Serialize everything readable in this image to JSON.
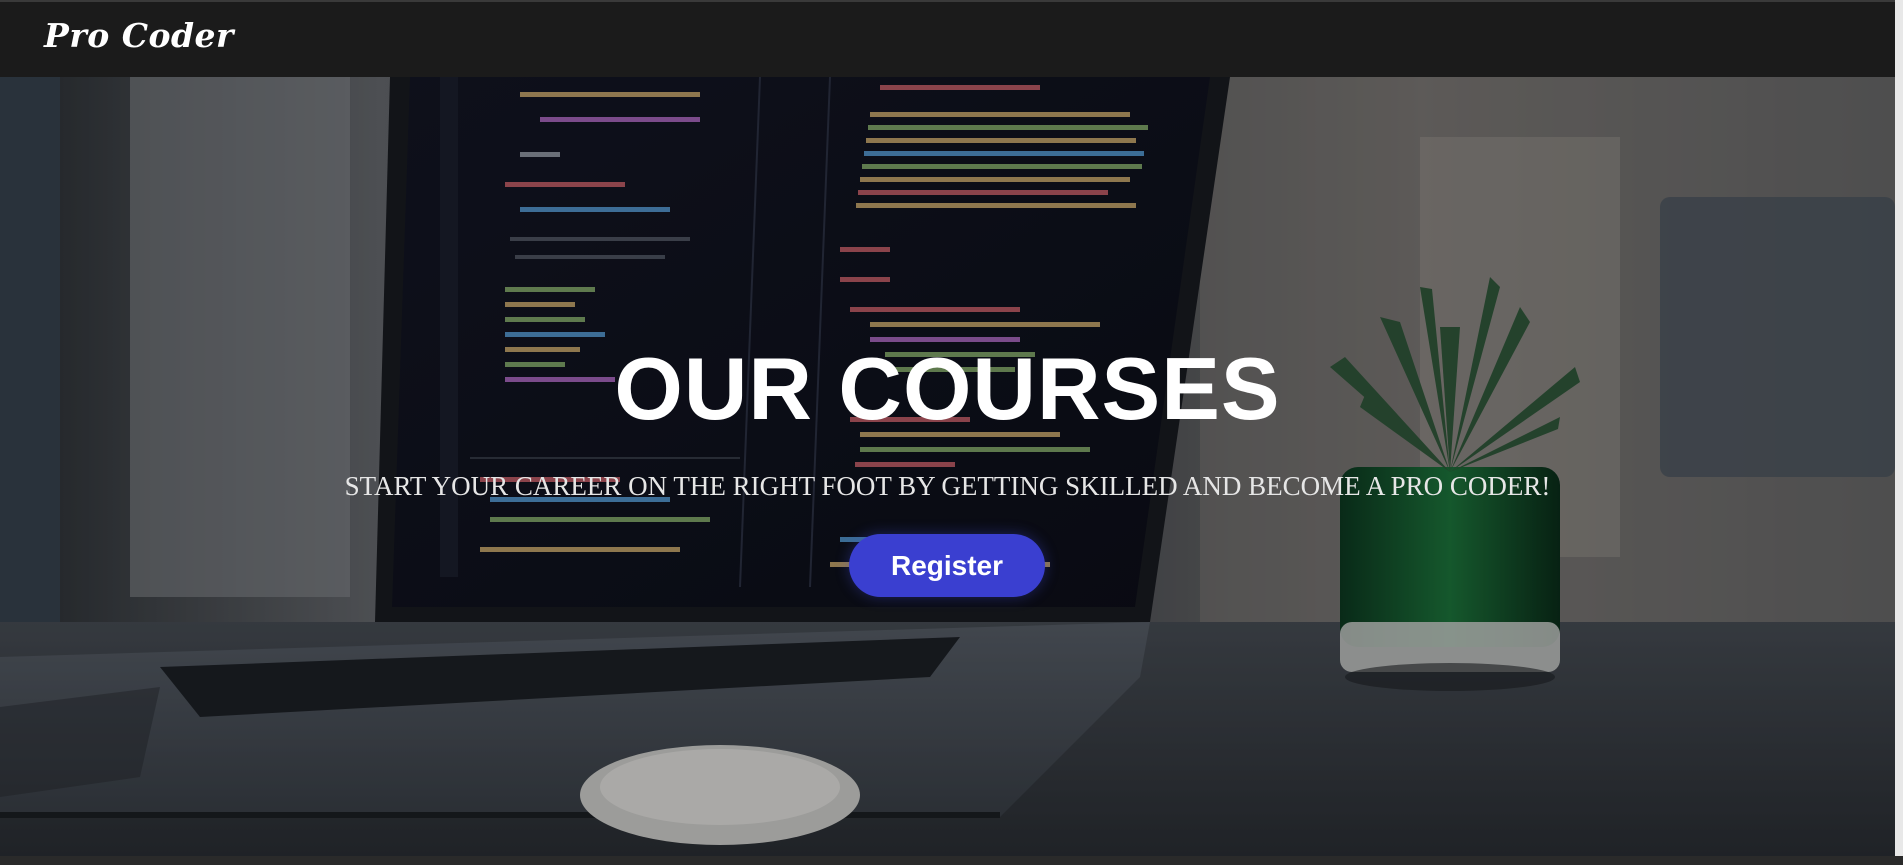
{
  "navbar": {
    "brand": "Pro Coder"
  },
  "hero": {
    "title": "OUR COURSES",
    "subtitle": "START YOUR CAREER ON THE RIGHT FOOT BY GETTING SKILLED AND BECOME A PRO CODER!",
    "register_label": "Register"
  },
  "colors": {
    "navbar_bg": "#1b1b1b",
    "button_bg": "#3a3fd0",
    "title_color": "#ffffff"
  },
  "icons": {
    "hero_background": "laptop-code-image"
  }
}
